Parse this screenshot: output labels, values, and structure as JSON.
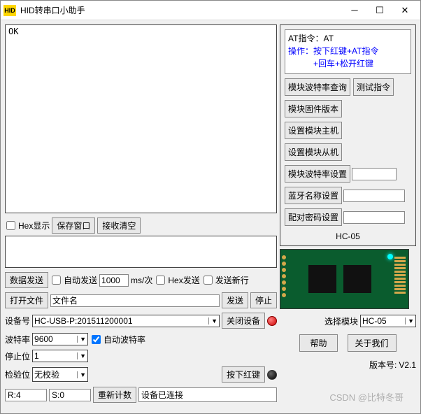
{
  "titlebar": {
    "icon_text": "HID",
    "title": "HID转串口小助手"
  },
  "main_text": "OK",
  "row_hex": {
    "hex_display": "Hex显示",
    "save_window": "保存窗口",
    "clear_recv": "接收清空"
  },
  "send_area": "",
  "data_send": {
    "label": "数据发送",
    "auto_send": "自动发送",
    "interval": "1000",
    "unit": "ms/次",
    "hex_send": "Hex发送",
    "send_newline": "发送新行"
  },
  "open_file": {
    "label": "打开文件",
    "filename": "文件名",
    "send": "发送",
    "stop": "停止"
  },
  "device": {
    "label": "设备号",
    "value": "HC-USB-P:201511200001",
    "close": "关闭设备"
  },
  "baud": {
    "label": "波特率",
    "value": "9600",
    "auto": "自动波特率"
  },
  "stopbit": {
    "label": "停止位",
    "value": "1"
  },
  "parity": {
    "label": "检验位",
    "value": "无校验",
    "press_red": "按下红键"
  },
  "status": {
    "r": "R:4",
    "s": "S:0",
    "reset": "重新计数",
    "connected": "设备已连接",
    "version_label": "版本号:",
    "version": "V2.1"
  },
  "right": {
    "at_cmd_label": "AT指令：",
    "at_cmd": "AT",
    "op_label": "操作：",
    "op_text": "按下红键+AT指令",
    "op_text2": "+回车+松开红键",
    "btn_query_baud": "模块波特率查询",
    "btn_test": "测试指令",
    "btn_firmware": "模块固件版本",
    "btn_set_master": "设置模块主机",
    "btn_set_slave": "设置模块从机",
    "btn_baud_set": "模块波特率设置",
    "baud_val": "",
    "btn_bt_name": "蓝牙名称设置",
    "bt_val": "",
    "btn_pair_pwd": "配对密码设置",
    "pwd_val": "",
    "module": "HC-05",
    "select_module": "选择模块",
    "select_val": "HC-05",
    "help": "帮助",
    "about": "关于我们"
  },
  "watermark": "CSDN @比特冬哥"
}
